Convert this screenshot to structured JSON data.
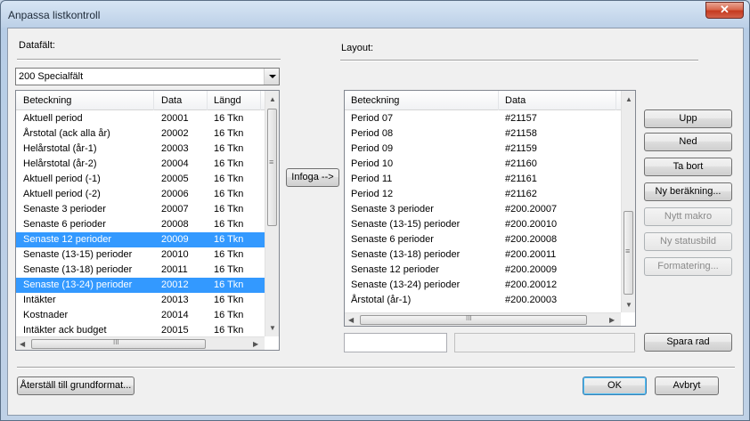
{
  "window": {
    "title": "Anpassa listkontroll",
    "close_glyph": "✕"
  },
  "left": {
    "section_label": "Datafält:",
    "combo_value": "200 Specialfält",
    "columns": [
      "Beteckning",
      "Data",
      "Längd"
    ],
    "rows": [
      {
        "name": "Aktuell period",
        "data": "20001",
        "len": "16 Tkn"
      },
      {
        "name": "Årstotal (ack alla år)",
        "data": "20002",
        "len": "16 Tkn"
      },
      {
        "name": "Helårstotal (år-1)",
        "data": "20003",
        "len": "16 Tkn"
      },
      {
        "name": "Helårstotal (år-2)",
        "data": "20004",
        "len": "16 Tkn"
      },
      {
        "name": "Aktuell period (-1)",
        "data": "20005",
        "len": "16 Tkn"
      },
      {
        "name": "Aktuell period (-2)",
        "data": "20006",
        "len": "16 Tkn"
      },
      {
        "name": "Senaste 3 perioder",
        "data": "20007",
        "len": "16 Tkn"
      },
      {
        "name": "Senaste 6 perioder",
        "data": "20008",
        "len": "16 Tkn"
      },
      {
        "name": "Senaste 12 perioder",
        "data": "20009",
        "len": "16 Tkn",
        "selected": true
      },
      {
        "name": "Senaste (13-15) perioder",
        "data": "20010",
        "len": "16 Tkn"
      },
      {
        "name": "Senaste (13-18) perioder",
        "data": "20011",
        "len": "16 Tkn"
      },
      {
        "name": "Senaste (13-24) perioder",
        "data": "20012",
        "len": "16 Tkn",
        "selected": true
      },
      {
        "name": "Intäkter",
        "data": "20013",
        "len": "16 Tkn"
      },
      {
        "name": "Kostnader",
        "data": "20014",
        "len": "16 Tkn"
      },
      {
        "name": "Intäkter ack budget",
        "data": "20015",
        "len": "16 Tkn"
      }
    ]
  },
  "insert_button": "Infoga -->",
  "right": {
    "section_label": "Layout:",
    "columns": [
      "Beteckning",
      "Data"
    ],
    "rows": [
      {
        "name": "Period 07",
        "data": "#21157"
      },
      {
        "name": "Period 08",
        "data": "#21158"
      },
      {
        "name": "Period 09",
        "data": "#21159"
      },
      {
        "name": "Period 10",
        "data": "#21160"
      },
      {
        "name": "Period 11",
        "data": "#21161"
      },
      {
        "name": "Period 12",
        "data": "#21162"
      },
      {
        "name": "Senaste 3 perioder",
        "data": "#200.20007"
      },
      {
        "name": "Senaste (13-15) perioder",
        "data": "#200.20010"
      },
      {
        "name": "Senaste 6 perioder",
        "data": "#200.20008"
      },
      {
        "name": "Senaste (13-18) perioder",
        "data": "#200.20011"
      },
      {
        "name": "Senaste 12 perioder",
        "data": "#200.20009"
      },
      {
        "name": "Senaste (13-24) perioder",
        "data": "#200.20012"
      },
      {
        "name": "Årstotal (år-1)",
        "data": "#200.20003"
      }
    ]
  },
  "side_buttons": {
    "up": "Upp",
    "down": "Ned",
    "remove": "Ta bort",
    "new_calc": "Ny beräkning...",
    "new_macro": "Nytt makro",
    "new_status": "Ny statusbild",
    "formatting": "Formatering...",
    "save_row": "Spara rad"
  },
  "footer": {
    "reset": "Återställ till grundformat...",
    "ok": "OK",
    "cancel": "Avbryt"
  },
  "scroll": {
    "up_glyph": "▲",
    "down_glyph": "▼",
    "left_glyph": "◀",
    "right_glyph": "▶",
    "grip_glyph": "≡",
    "hgrip_glyph": "III"
  },
  "colors": {
    "selection": "#3399ff",
    "close_button": "#c53a1f"
  }
}
